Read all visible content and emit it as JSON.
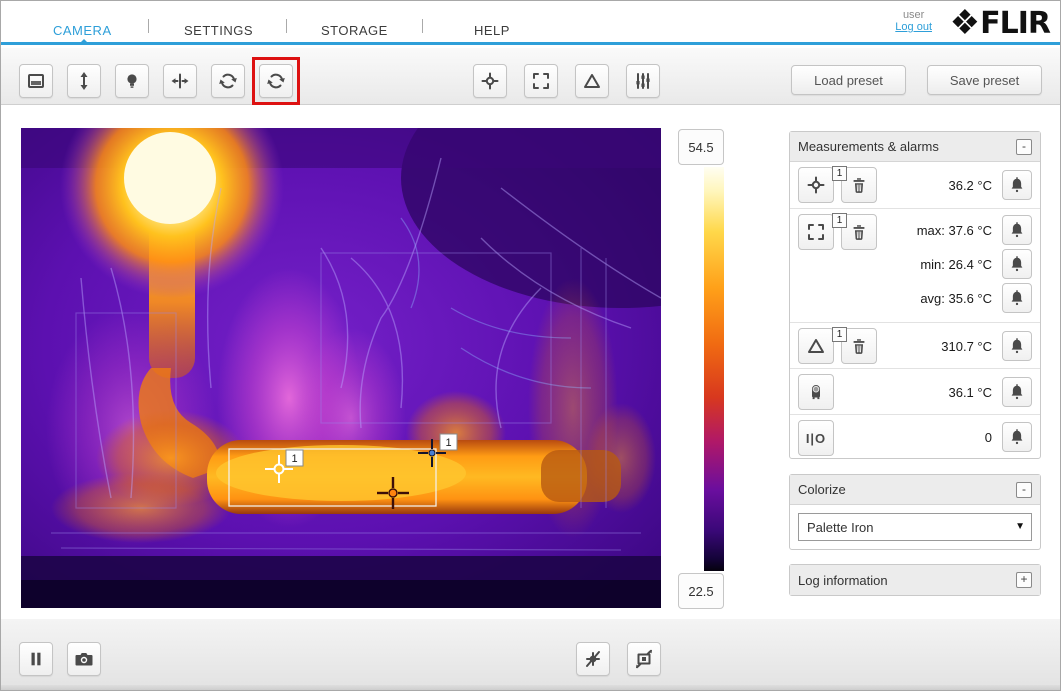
{
  "nav": {
    "items": [
      {
        "label": "CAMERA",
        "active": true
      },
      {
        "label": "SETTINGS",
        "active": false
      },
      {
        "label": "STORAGE",
        "active": false
      },
      {
        "label": "HELP",
        "active": false
      }
    ],
    "user_label": "user",
    "logout_label": "Log out",
    "brand_mark": "❖",
    "brand_name": "FLIR",
    "accent_color": "#2e9fd9"
  },
  "toolbar": {
    "left_icons": [
      "display-mode-icon",
      "move-vertical-icon",
      "lamp-icon",
      "split-horizontal-icon",
      "rotate-ccw-icon",
      "rotate-cw-icon"
    ],
    "highlighted_icon": "rotate-cw-icon",
    "highlight_color": "#dd1111",
    "center_icons": [
      "spot-meter-icon",
      "area-box-icon",
      "delta-icon",
      "sliders-icon"
    ],
    "load_preset_label": "Load preset",
    "save_preset_label": "Save preset"
  },
  "scale": {
    "max": "54.5",
    "min": "22.5"
  },
  "measurements": {
    "title": "Measurements & alarms",
    "collapse_label": "-",
    "rows": [
      {
        "tool": "spot-meter",
        "badge": "1",
        "lines": [
          "36.2 °C"
        ]
      },
      {
        "tool": "area-box",
        "badge": "1",
        "lines": [
          "max: 37.6 °C",
          "min: 26.4 °C",
          "avg: 35.6 °C"
        ]
      },
      {
        "tool": "delta",
        "badge": "1",
        "lines": [
          "310.7 °C"
        ]
      },
      {
        "tool": "camera-internal-temp",
        "lines": [
          "36.1 °C"
        ]
      },
      {
        "tool": "digital-io",
        "io_label": "I|O",
        "lines": [
          "0"
        ]
      }
    ]
  },
  "colorize": {
    "title": "Colorize",
    "collapse_label": "-",
    "palette_value": "Palette Iron",
    "caret": "▼"
  },
  "log": {
    "title": "Log information",
    "expand_label": "+"
  },
  "image_markers": {
    "spot_badge": "1",
    "box_badge": "1"
  },
  "footer_icons": [
    "pause-icon",
    "snapshot-icon",
    "hide-overlay-icon",
    "resize-image-icon"
  ]
}
